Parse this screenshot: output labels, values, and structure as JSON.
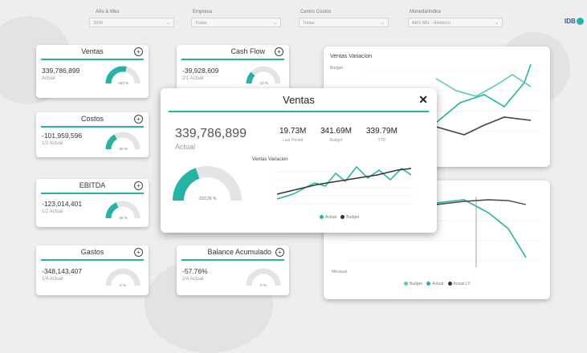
{
  "filters": [
    {
      "label": "Año & Mes",
      "value": "2020"
    },
    {
      "label": "Empresa",
      "value": "Todas"
    },
    {
      "label": "Centro Costos",
      "value": "Todas"
    },
    {
      "label": "Moneda/Indice",
      "value": "ARS MG - Histórico"
    }
  ],
  "logo": "IDB",
  "cards": {
    "ventas": {
      "title": "Ventas",
      "value": "339,786,899",
      "sub": "Actual",
      "gauge": "-333 %"
    },
    "cashflow": {
      "title": "Cash Flow",
      "value": "-39,928,609",
      "sub": "2/1 Actual",
      "gauge": "-13 %"
    },
    "costos": {
      "title": "Costos",
      "value": "-101,959,596",
      "sub": "1/2 Actual",
      "gauge": "-30 %"
    },
    "ebitda": {
      "title": "EBITDA",
      "value": "-123,014,401",
      "sub": "1/2 Actual",
      "gauge": "-36 %"
    },
    "gastos": {
      "title": "Gastos",
      "value": "-348,143,407",
      "sub": "1/4 Actual",
      "gauge": "0 %"
    },
    "balance": {
      "title": "Balance Acumulado",
      "value": "-57.76%",
      "sub": "2/4 Actual",
      "gauge": "0 %"
    }
  },
  "panels": {
    "top": {
      "title": "Ventas Variacion",
      "subtitle": "Budget"
    },
    "bottom": {
      "subtitle": "Mensual",
      "legend": [
        "Budget",
        "Actual",
        "Actual LY"
      ]
    }
  },
  "modal": {
    "title": "Ventas",
    "close": "✕",
    "big_value": "339,786,899",
    "big_sub": "Actual",
    "gauge": "-333,26 %",
    "stats": [
      {
        "value": "19.73M",
        "label": "Last Period"
      },
      {
        "value": "341.69M",
        "label": "Budget"
      },
      {
        "value": "339.79M",
        "label": "YTD"
      }
    ],
    "chart_title": "Ventas Variacion",
    "legend": [
      "Actual",
      "Budget"
    ]
  },
  "colors": {
    "accent": "#25b3a3",
    "dark": "#333333",
    "gauge_bg": "#e4e4e4"
  }
}
